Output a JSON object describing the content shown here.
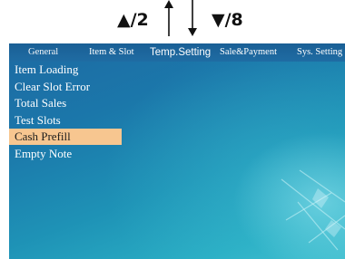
{
  "hints": {
    "up_label": "▲/2",
    "down_label": "▼/8"
  },
  "tabs": [
    {
      "label": "General",
      "selected": false
    },
    {
      "label": "Item & Slot",
      "selected": false
    },
    {
      "label": "Temp.Setting",
      "selected": true
    },
    {
      "label": "Sale&Payment",
      "selected": false
    },
    {
      "label": "Sys. Setting",
      "selected": false
    }
  ],
  "menu": {
    "items": [
      {
        "label": "Item Loading",
        "selected": false
      },
      {
        "label": "Clear Slot Error",
        "selected": false
      },
      {
        "label": "Total Sales",
        "selected": false
      },
      {
        "label": "Test Slots",
        "selected": false
      },
      {
        "label": "Cash Prefill",
        "selected": true
      },
      {
        "label": "Empty Note",
        "selected": false
      }
    ]
  },
  "colors": {
    "selection_highlight": "#f7c690",
    "screen_background": "#1e80b0",
    "tab_bar": "#1c6399",
    "menu_text": "#ffffff"
  },
  "icons": [
    "arrow-up-icon",
    "arrow-down-icon"
  ]
}
